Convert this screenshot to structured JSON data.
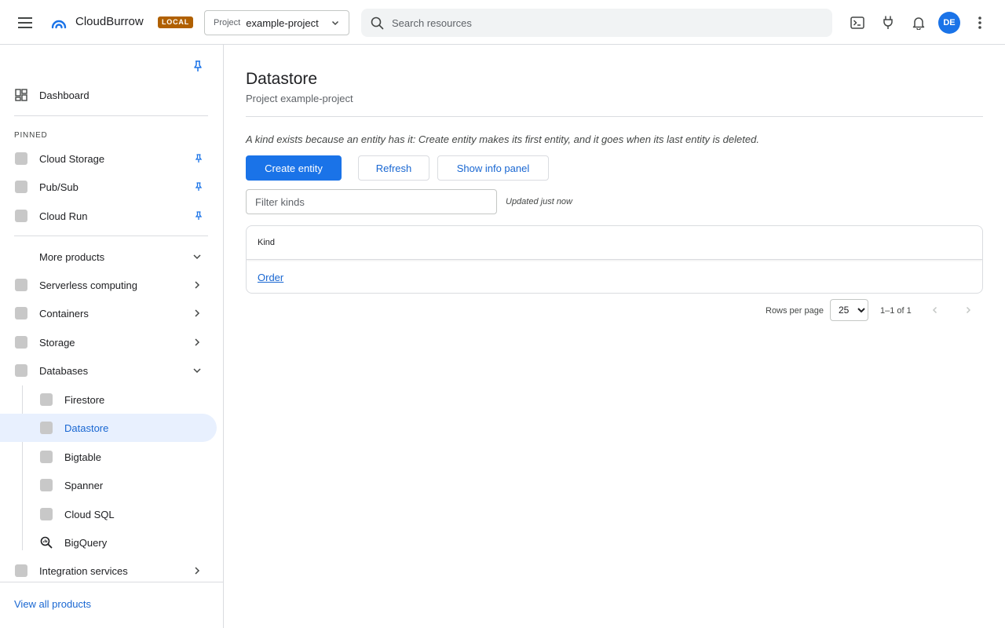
{
  "app": {
    "name": "CloudBurrow",
    "env_badge": "LOCAL"
  },
  "project_picker": {
    "label": "Project",
    "value": "example-project"
  },
  "search": {
    "placeholder": "Search resources"
  },
  "user": {
    "initials": "DE"
  },
  "colors": {
    "accent": "#1a73e8",
    "badge": "#b06000",
    "active_bg": "#e8f0fe"
  },
  "sidebar": {
    "dashboard": "Dashboard",
    "pinned_header": "PINNED",
    "pinned": [
      {
        "label": "Cloud Storage"
      },
      {
        "label": "Pub/Sub"
      },
      {
        "label": "Cloud Run"
      }
    ],
    "more_products": "More products",
    "categories": [
      {
        "label": "Serverless computing"
      },
      {
        "label": "Containers"
      },
      {
        "label": "Storage"
      },
      {
        "label": "Databases"
      }
    ],
    "database_items": [
      {
        "label": "Firestore"
      },
      {
        "label": "Datastore"
      },
      {
        "label": "Bigtable"
      },
      {
        "label": "Spanner"
      },
      {
        "label": "Cloud SQL"
      },
      {
        "label": "BigQuery"
      }
    ],
    "integration": "Integration services",
    "view_all": "View all products"
  },
  "main": {
    "title": "Datastore",
    "subtitle": "Project example-project",
    "hint": "A kind exists because an entity has it: Create entity makes its first entity, and it goes when its last entity is deleted.",
    "buttons": {
      "create": "Create entity",
      "refresh": "Refresh",
      "info_panel": "Show info panel"
    },
    "filter_placeholder": "Filter kinds",
    "updated": "Updated just now",
    "table": {
      "header": "Kind",
      "rows": [
        {
          "kind": "Order"
        }
      ]
    },
    "pagination": {
      "rows_per_page_label": "Rows per page",
      "rows_per_page": "25",
      "range": "1–1 of 1"
    }
  }
}
